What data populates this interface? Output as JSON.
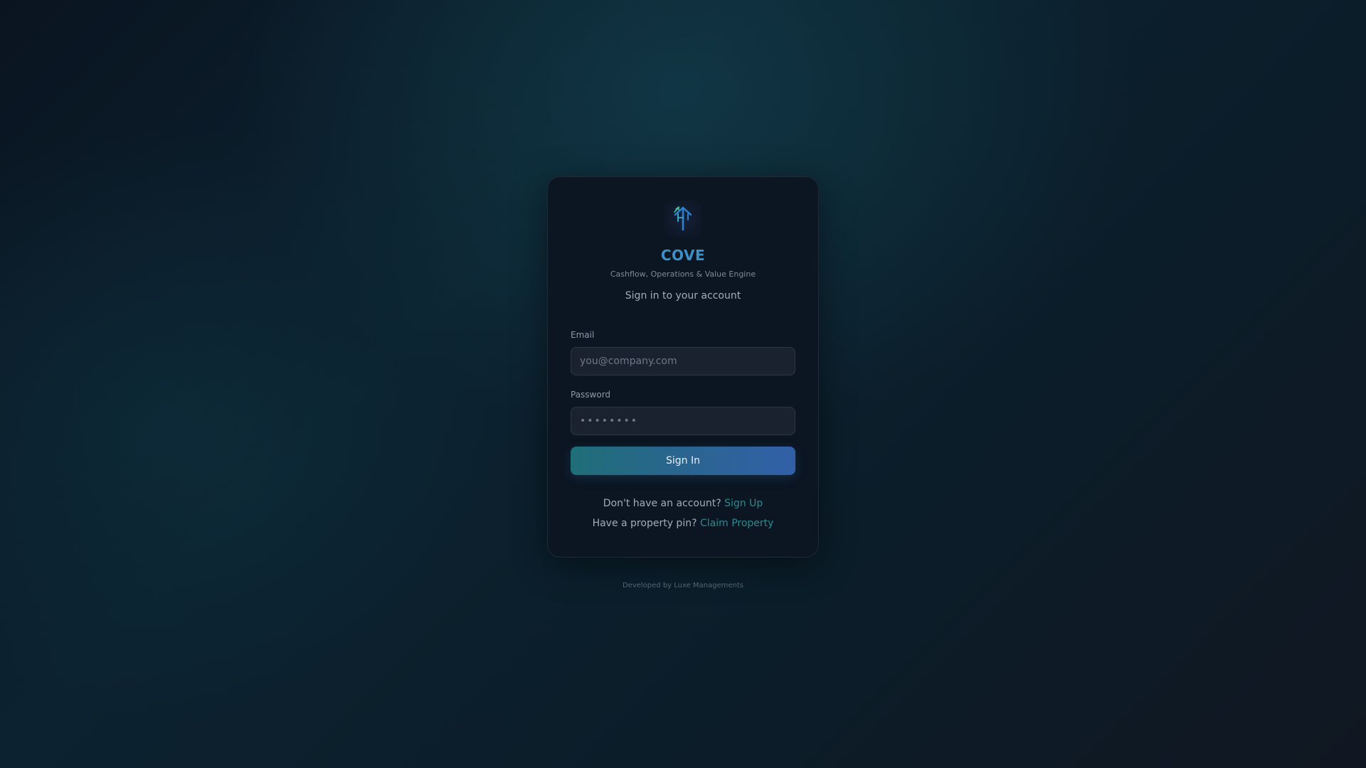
{
  "brand": {
    "name": "COVE",
    "tagline": "Cashflow, Operations & Value Engine",
    "logo_icon": "house-arrows-logo-icon",
    "accent_color": "#3d8fc8"
  },
  "form": {
    "subtitle": "Sign in to your account",
    "email": {
      "label": "Email",
      "value": "",
      "placeholder": "you@company.com"
    },
    "password": {
      "label": "Password",
      "value": "",
      "placeholder": "••••••••"
    },
    "submit_label": "Sign In"
  },
  "links": {
    "signup_prompt": "Don't have an account?",
    "signup_label": "Sign Up",
    "claim_prompt": "Have a property pin?",
    "claim_label": "Claim Property",
    "link_color": "#2a8c8f"
  },
  "footer": {
    "credit": "Developed by Luxe Managements"
  }
}
